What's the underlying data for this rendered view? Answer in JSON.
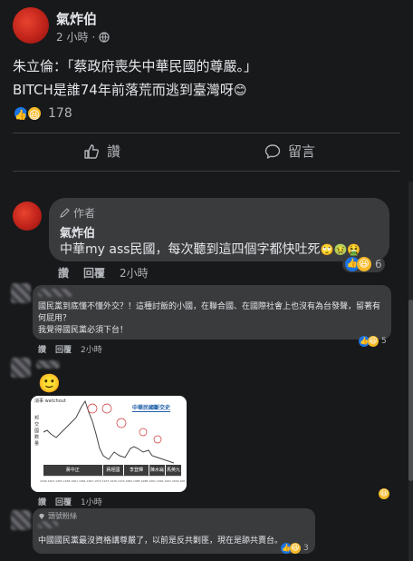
{
  "post": {
    "author": "氣炸伯",
    "time": "2 小時",
    "line1": "朱立倫：「蔡政府喪失中華民國的尊嚴。」",
    "line2": "BITCH是誰74年前落荒而逃到臺灣呀",
    "line2_emoji": "😊",
    "reaction_count": "178",
    "like_button": "讚",
    "comment_button": "留言"
  },
  "comments": [
    {
      "author_badge": "作者",
      "author": "氣炸伯",
      "text": "中華my ass民國，每次聽到這四個字都快吐死",
      "text_emoji": "🙄🤢🤮",
      "like_action": "讚",
      "reply_action": "回覆",
      "time": "2小時",
      "reaction_count": "6"
    },
    {
      "text": "國民黨到底懂不懂外交？！這種討飯的小國，在聯合國、在國際社會上也沒有為台發聲，留著有何屁用？\n我覺得國民黨必須下台！",
      "like_action": "讚",
      "reply_action": "回覆",
      "time": "2小時",
      "reaction_count": "5"
    },
    {
      "emoji": "🙂",
      "chart_tag": "消事 watchout",
      "chart_title": "中華民國斷交史",
      "chart_ylabel": "邦交國數量",
      "chart_leaders": [
        "蔣中正",
        "蔣經國",
        "李登輝",
        "陳水扁",
        "馬英九"
      ],
      "chart_years": "1949 1952 1955 1958 1961 1964 1967 1970 1973 1976 1979 1982 1985 1988 1991 1994 1997 2000 2003 2006 2009 2012 2015",
      "like_action": "讚",
      "reply_action": "回覆",
      "time": "1小時"
    },
    {
      "badge": "頭號粉絲",
      "text": "中國國民黨最沒資格講尊嚴了，以前是反共剿匪，現在是舔共賣台。",
      "reaction_count": "3"
    }
  ],
  "colors": {
    "background": "#18191a",
    "bubble": "#3a3b3c",
    "like_blue": "#1b74e4",
    "text": "#e4e6eb",
    "muted": "#b0b3b8"
  }
}
